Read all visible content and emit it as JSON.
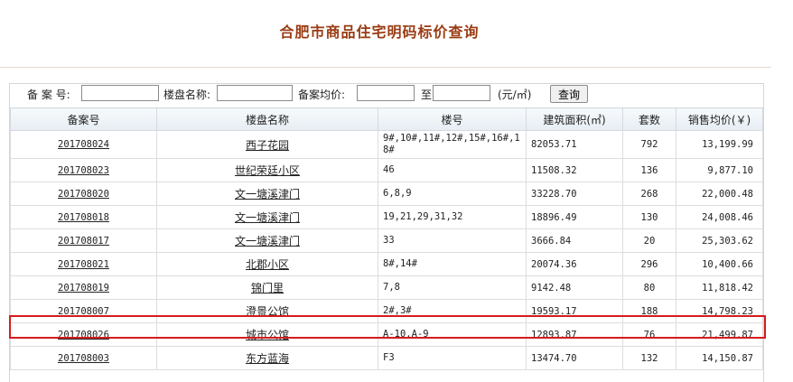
{
  "page": {
    "title": "合肥市商品住宅明码标价查询"
  },
  "search": {
    "record_label": "备 案 号:",
    "name_label": "楼盘名称:",
    "avg_label": "备案均价:",
    "to_label": "至",
    "unit_label": "(元/㎡)",
    "query_button": "查询",
    "record_value": "",
    "name_value": "",
    "avg_min_value": "",
    "avg_max_value": ""
  },
  "table": {
    "headers": [
      "备案号",
      "楼盘名称",
      "楼号",
      "建筑面积(㎡)",
      "套数",
      "销售均价(￥)"
    ],
    "rows": [
      {
        "code": "201708024",
        "name": "西子花园",
        "buildings": "9#,10#,11#,12#,15#,16#,18#",
        "area": "82053.71",
        "units": "792",
        "price": "13,199.99"
      },
      {
        "code": "201708023",
        "name": "世纪荣廷小区",
        "buildings": "46",
        "area": "11508.32",
        "units": "136",
        "price": "9,877.10"
      },
      {
        "code": "201708020",
        "name": "文一塘溪津门",
        "buildings": "6,8,9",
        "area": "33228.70",
        "units": "268",
        "price": "22,000.48"
      },
      {
        "code": "201708018",
        "name": "文一塘溪津门",
        "buildings": "19,21,29,31,32",
        "area": "18896.49",
        "units": "130",
        "price": "24,008.46"
      },
      {
        "code": "201708017",
        "name": "文一塘溪津门",
        "buildings": "33",
        "area": "3666.84",
        "units": "20",
        "price": "25,303.62"
      },
      {
        "code": "201708021",
        "name": "北郡小区",
        "buildings": "8#,14#",
        "area": "20074.36",
        "units": "296",
        "price": "10,400.66"
      },
      {
        "code": "201708019",
        "name": "锦门里",
        "buildings": "7,8",
        "area": "9142.48",
        "units": "80",
        "price": "11,818.42"
      },
      {
        "code": "201708007",
        "name": "澄景公馆",
        "buildings": "2#,3#",
        "area": "19593.17",
        "units": "188",
        "price": "14,798.23"
      },
      {
        "code": "201708026",
        "name": "城市公馆",
        "buildings": "A-10,A-9",
        "area": "12893.87",
        "units": "76",
        "price": "21,499.87"
      },
      {
        "code": "201708003",
        "name": "东方蓝海",
        "buildings": "F3",
        "area": "13474.70",
        "units": "132",
        "price": "14,150.87"
      }
    ]
  },
  "colors": {
    "title": "#9a3b12",
    "highlight": "#d41c1c"
  }
}
